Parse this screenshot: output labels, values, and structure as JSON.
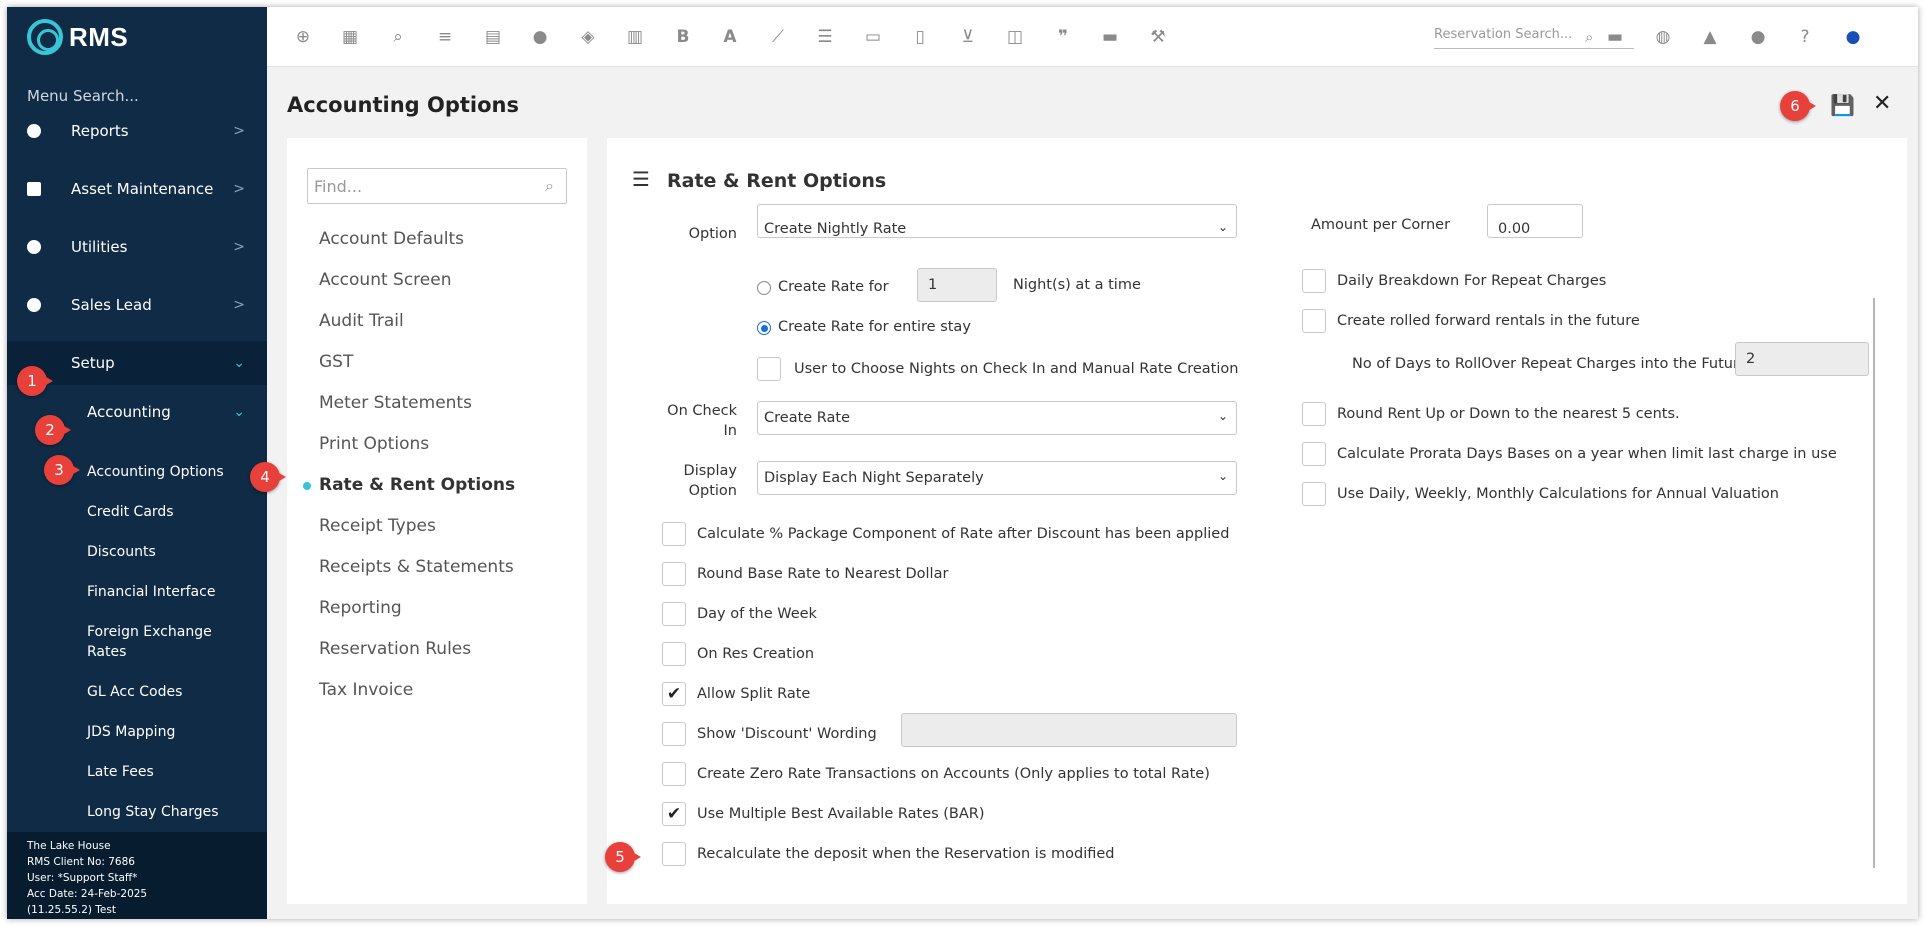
{
  "app": {
    "logo_text": "RMS"
  },
  "sidebar": {
    "menu_search": "Menu Search...",
    "items": [
      {
        "label": "Reports",
        "icon": "pie-chart-icon"
      },
      {
        "label": "Asset Maintenance",
        "icon": "briefcase-icon"
      },
      {
        "label": "Utilities",
        "icon": "gauge-icon"
      },
      {
        "label": "Sales Lead",
        "icon": "check-circle-icon"
      },
      {
        "label": "Setup",
        "icon": ""
      }
    ],
    "accounting_label": "Accounting",
    "sub_items": [
      "Accounting Options",
      "Credit Cards",
      "Discounts",
      "Financial Interface",
      "Foreign Exchange Rates",
      "GL Acc Codes",
      "JDS Mapping",
      "Late Fees",
      "Long Stay Charges"
    ],
    "footer": {
      "property": "The Lake House",
      "client_no": "RMS Client No: 7686",
      "user": "User: *Support Staff*",
      "acc_date": "Acc Date: 24-Feb-2025",
      "version": "(11.25.55.2) Test"
    }
  },
  "topbar": {
    "icons": [
      "plus-circle-icon",
      "calendar-icon",
      "search-icon",
      "sliders-icon",
      "grid-icon",
      "users-icon",
      "map-pin-icon",
      "map-icon",
      "bold-icon",
      "font-icon",
      "line-chart-icon",
      "checklist-icon",
      "id-card-icon",
      "invoice-icon",
      "cart-icon",
      "ticket-icon",
      "quote-icon",
      "bed-icon",
      "hammer-icon"
    ],
    "reservation_search_placeholder": "Reservation Search...",
    "right_icons": [
      "globe-icon",
      "bell-icon",
      "chat-icon",
      "help-icon",
      "user-icon"
    ]
  },
  "page": {
    "title": "Accounting Options"
  },
  "left_panel": {
    "find_placeholder": "Find...",
    "options": [
      "Account Defaults",
      "Account Screen",
      "Audit Trail",
      "GST",
      "Meter Statements",
      "Print Options",
      "Rate & Rent Options",
      "Receipt Types",
      "Receipts & Statements",
      "Reporting",
      "Reservation Rules",
      "Tax Invoice"
    ],
    "active_index": 6
  },
  "rate_rent": {
    "section_title": "Rate & Rent Options",
    "option_label": "Option",
    "option_value": "Create Nightly Rate",
    "create_rate_for_label": "Create Rate for",
    "create_rate_for_value": "1",
    "nights_at_a_time": "Night(s) at a time",
    "create_rate_entire_stay": "Create Rate for entire stay",
    "user_choose_nights": "User to Choose Nights on Check In and Manual Rate Creation",
    "on_check_in_label_1": "On Check",
    "on_check_in_label_2": "In",
    "on_check_in_value": "Create Rate",
    "display_option_label_1": "Display",
    "display_option_label_2": "Option",
    "display_option_value": "Display Each Night Separately",
    "checkboxes_left": [
      {
        "label": "Calculate % Package Component of Rate after Discount has been applied",
        "checked": false
      },
      {
        "label": "Round Base Rate to Nearest Dollar",
        "checked": false
      },
      {
        "label": "Day of the Week",
        "checked": false
      },
      {
        "label": "On Res Creation",
        "checked": false
      },
      {
        "label": "Allow Split Rate",
        "checked": true
      },
      {
        "label": "Show 'Discount' Wording",
        "checked": false
      },
      {
        "label": "Create Zero Rate Transactions on Accounts (Only applies to total Rate)",
        "checked": false
      },
      {
        "label": "Use Multiple Best Available Rates (BAR)",
        "checked": true
      },
      {
        "label": "Recalculate the deposit when the Reservation is modified",
        "checked": false
      }
    ],
    "amount_per_corner_label": "Amount per Corner",
    "amount_per_corner_value": "0.00",
    "checkboxes_right": [
      {
        "label": "Daily Breakdown For Repeat Charges",
        "checked": false
      },
      {
        "label": "Create rolled forward rentals in the future",
        "checked": false
      }
    ],
    "rollover_days_label": "No of Days to RollOver Repeat Charges into the Future",
    "rollover_days_value": "2",
    "checkboxes_right_2": [
      {
        "label": "Round Rent Up or Down to the nearest 5 cents.",
        "checked": false
      },
      {
        "label": "Calculate Prorata Days Bases on a year when limit last charge in use",
        "checked": false
      },
      {
        "label": "Use Daily, Weekly, Monthly Calculations for Annual Valuation",
        "checked": false
      }
    ]
  },
  "callouts": [
    "1",
    "2",
    "3",
    "4",
    "5",
    "6"
  ],
  "colors": {
    "sidebar_bg": "#0f2b46",
    "accent": "#39c5d8",
    "callout": "#e8403a"
  }
}
